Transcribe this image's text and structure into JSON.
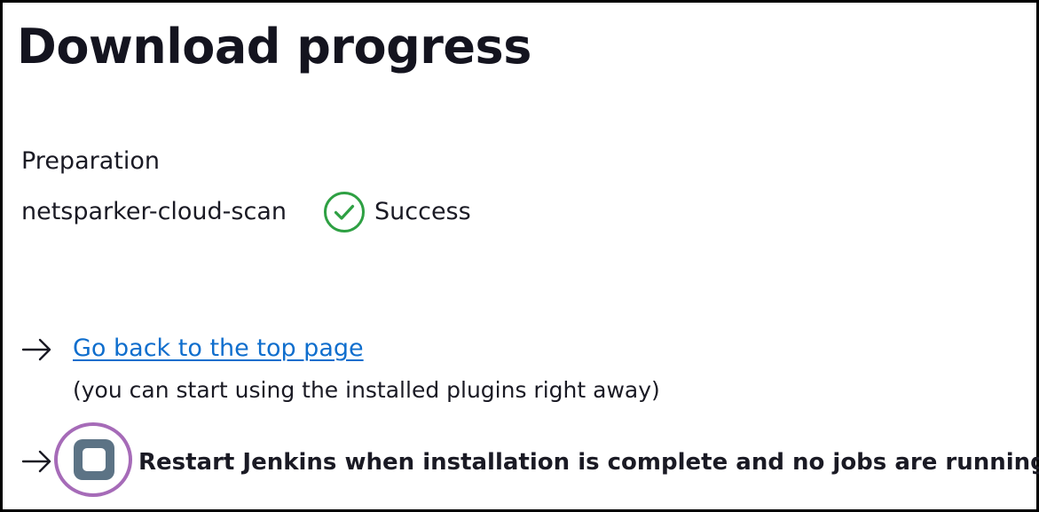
{
  "page": {
    "title": "Download progress"
  },
  "progress": {
    "preparation_label": "Preparation",
    "plugins": [
      {
        "name": "netsparker-cloud-scan",
        "status": "Success",
        "status_icon": "check-circle-icon",
        "status_color": "#2ea043"
      }
    ]
  },
  "actions": {
    "top_page_link": "Go back to the top page",
    "top_page_hint": "(you can start using the installed plugins right away)",
    "restart_label": "Restart Jenkins when installation is complete and no jobs are running",
    "restart_checked": false,
    "link_color": "#0f6ecd",
    "highlight_color": "#a66bb8"
  }
}
